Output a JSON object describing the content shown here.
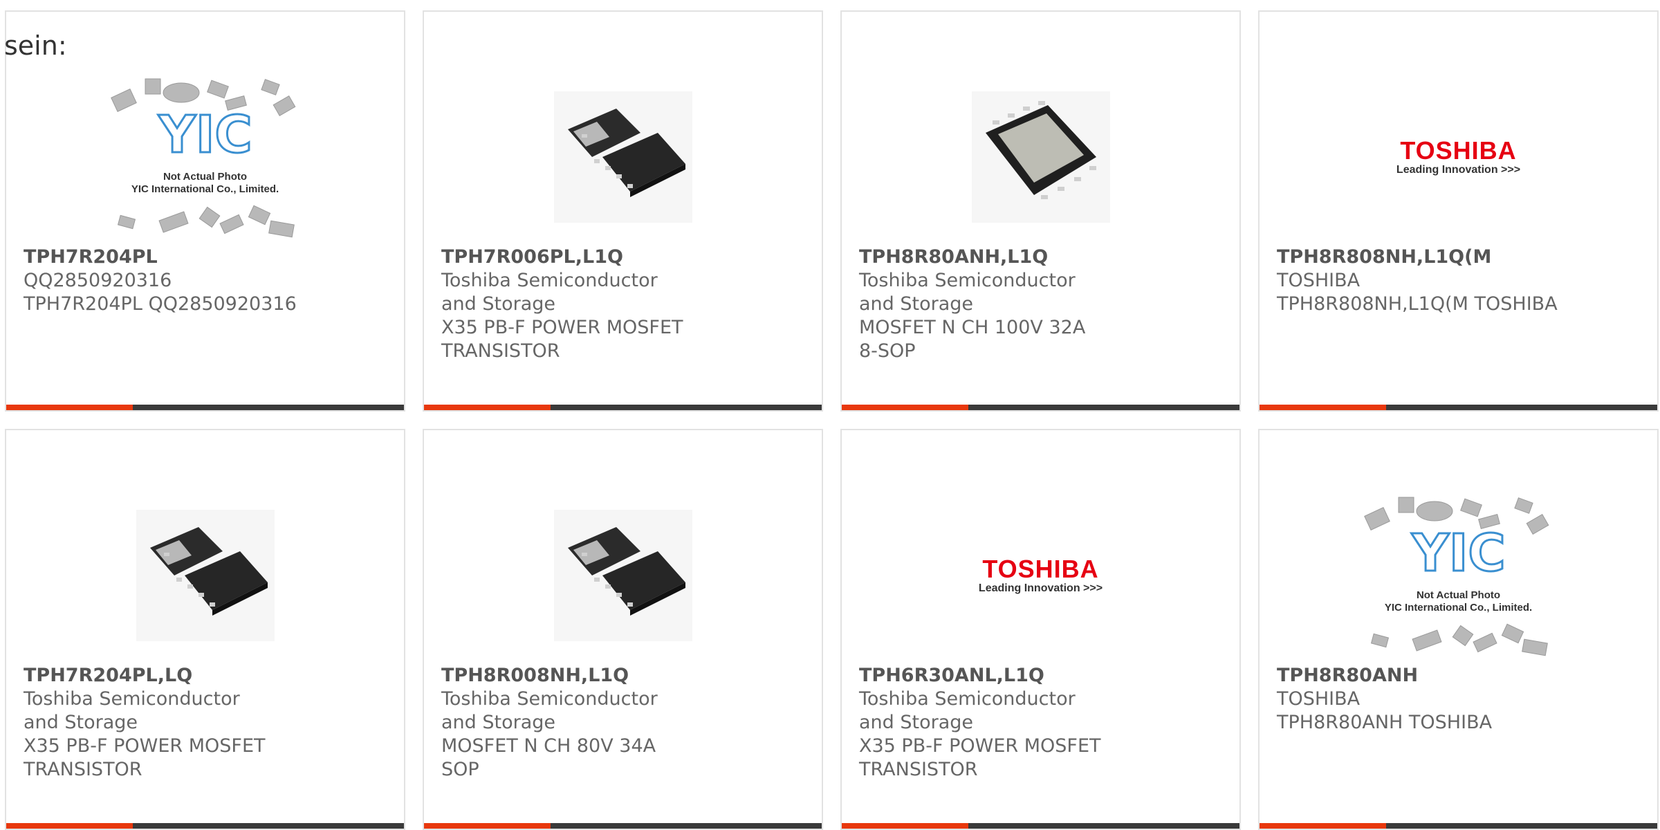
{
  "lead_text": "sein:",
  "colors": {
    "accent": "#e8380d",
    "bar": "#3a3a3a",
    "toshiba_red": "#e60012",
    "yic_blue": "#3a8fd0"
  },
  "cards": [
    {
      "part_number": "TPH7R204PL",
      "image": "yic-placeholder-photo",
      "yic_caption_line1": "Not Actual Photo",
      "yic_caption_line2": "YIC International Co., Limited.",
      "line1": "QQ2850920316",
      "line2": "TPH7R204PL QQ2850920316"
    },
    {
      "part_number": "TPH7R006PL,L1Q",
      "image": "mosfet-dual-package-photo",
      "line1": "Toshiba Semiconductor and Storage",
      "line2": "X35 PB-F POWER MOSFET TRANSISTOR"
    },
    {
      "part_number": "TPH8R80ANH,L1Q",
      "image": "mosfet-sop-package-photo",
      "line1": "Toshiba Semiconductor and Storage",
      "line2": "MOSFET N CH 100V 32A 8-SOP"
    },
    {
      "part_number": "TPH8R808NH,L1Q(M",
      "image": "toshiba-logo",
      "logo_brand": "TOSHIBA",
      "logo_tagline": "Leading Innovation >>>",
      "line1": "TOSHIBA",
      "line2": "TPH8R808NH,L1Q(M TOSHIBA"
    },
    {
      "part_number": "TPH7R204PL,LQ",
      "image": "mosfet-dual-package-photo",
      "line1": "Toshiba Semiconductor and Storage",
      "line2": "X35 PB-F POWER MOSFET TRANSISTOR"
    },
    {
      "part_number": "TPH8R008NH,L1Q",
      "image": "mosfet-dual-package-photo",
      "line1": "Toshiba Semiconductor and Storage",
      "line2": "MOSFET N CH 80V 34A SOP"
    },
    {
      "part_number": "TPH6R30ANL,L1Q",
      "image": "toshiba-logo",
      "logo_brand": "TOSHIBA",
      "logo_tagline": "Leading Innovation >>>",
      "line1": "Toshiba Semiconductor and Storage",
      "line2": "X35 PB-F POWER MOSFET TRANSISTOR"
    },
    {
      "part_number": "TPH8R80ANH",
      "image": "yic-placeholder-photo",
      "yic_caption_line1": "Not Actual Photo",
      "yic_caption_line2": "YIC International Co., Limited.",
      "line1": "TOSHIBA",
      "line2": "TPH8R80ANH TOSHIBA"
    }
  ]
}
